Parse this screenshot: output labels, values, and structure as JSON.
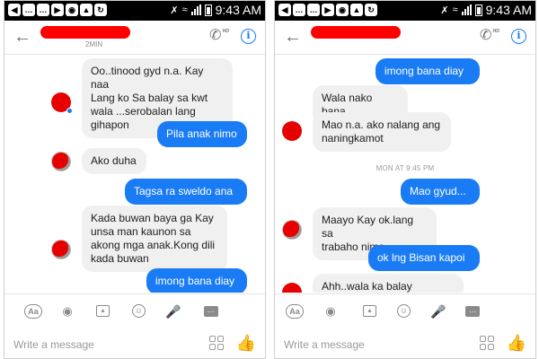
{
  "statusbar": {
    "time": "9:43 AM",
    "left_icons": [
      "back-icon",
      "message-icon",
      "message-icon",
      "video-icon",
      "camera-icon",
      "app-icon",
      "sync-icon"
    ]
  },
  "left": {
    "header": {
      "subtitle": "2MIN"
    },
    "messages": [
      {
        "dir": "in",
        "text": "Oo..tinood gyd n.a. Kay naa\nLang ko Sa balay sa kwt\nwala ...serobalan lang\ngihapon"
      },
      {
        "dir": "out",
        "text": "Pila anak nimo"
      },
      {
        "dir": "in",
        "text": "Ako duha"
      },
      {
        "dir": "out",
        "text": "Tagsa ra sweldo ana"
      },
      {
        "dir": "in",
        "text": "Kada buwan baya ga Kay\nunsa man kaunon sa\nakong mga anak.Kong dili\nkada buwan"
      },
      {
        "dir": "out",
        "text": "imong bana diay"
      }
    ],
    "input_placeholder": "Write a message"
  },
  "right": {
    "header": {
      "subtitle": ""
    },
    "messages": [
      {
        "dir": "out",
        "text": "imong bana diay"
      },
      {
        "dir": "in",
        "text": "Wala nako bana"
      },
      {
        "dir": "in",
        "text": "Mao n.a. ako nalang ang\nnaningkamot"
      },
      {
        "dir": "out",
        "text": "Mao gyud..."
      },
      {
        "dir": "in",
        "text": "Maayo Kay ok.lang sa\ntrabaho nimo"
      },
      {
        "dir": "out",
        "text": "ok lng Bisan kapoi"
      },
      {
        "dir": "in",
        "text": "Ahh..wala ka balay"
      }
    ],
    "timestamp": "MON AT 9:45 PM",
    "input_placeholder": "Write a message"
  },
  "toolbar": {
    "aa_label": "Aa",
    "icons": [
      "text-format-icon",
      "camera-icon",
      "gallery-icon",
      "emoji-icon",
      "microphone-icon",
      "more-icon"
    ]
  },
  "colors": {
    "accent": "#1a7cf4",
    "incoming_bubble": "#f0f0f0",
    "redaction": "#e60000"
  }
}
